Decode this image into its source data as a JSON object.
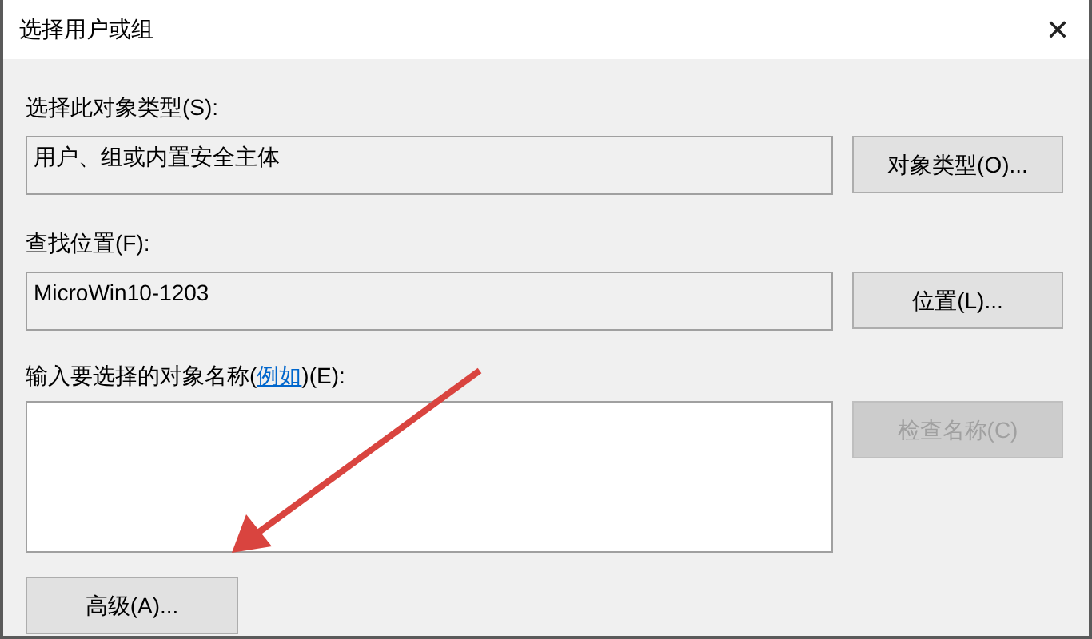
{
  "window": {
    "title": "选择用户或组",
    "close": "✕"
  },
  "object_type": {
    "label": "选择此对象类型(S):",
    "value": "用户、组或内置安全主体",
    "button": "对象类型(O)..."
  },
  "location": {
    "label": "查找位置(F):",
    "value": "MicroWin10-1203",
    "button": "位置(L)..."
  },
  "names": {
    "label_before": "输入要选择的对象名称(",
    "link": "例如",
    "label_after": ")(E):",
    "check_button": {
      "label": "检查名称(C)",
      "disabled": true
    }
  },
  "advanced_button": "高级(A)..."
}
